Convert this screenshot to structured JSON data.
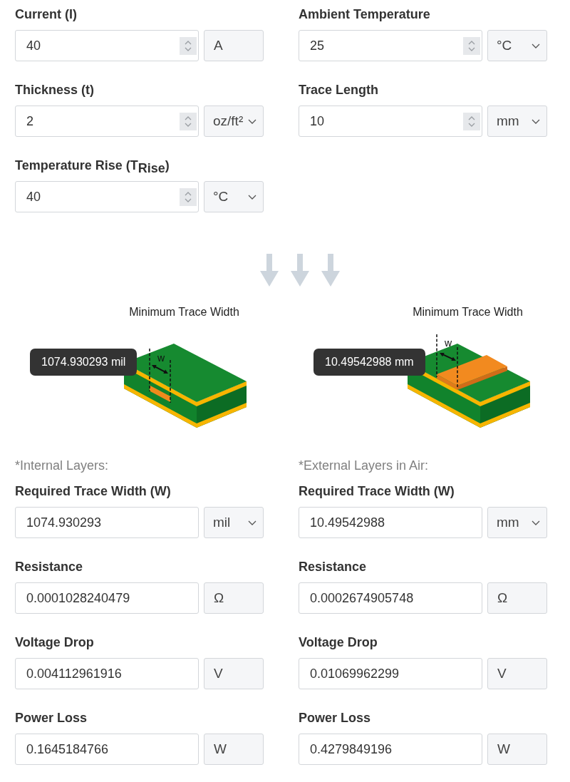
{
  "inputs": [
    {
      "label": "Current (I)",
      "value": "40",
      "unit": {
        "text": "A",
        "kind": "fixed"
      }
    },
    {
      "label": "Ambient Temperature",
      "value": "25",
      "unit": {
        "text": "°C",
        "kind": "dropdown"
      }
    },
    {
      "label": "Thickness (t)",
      "value": "2",
      "unit": {
        "text": "oz/ft²",
        "kind": "dropdown"
      }
    },
    {
      "label": "Trace Length",
      "value": "10",
      "unit": {
        "text": "mm",
        "kind": "dropdown"
      }
    },
    {
      "label": "Temperature Rise (T$_{Rise}$)",
      "value": "40",
      "unit": {
        "text": "°C",
        "kind": "dropdown"
      }
    }
  ],
  "results": [
    {
      "diagram": {
        "title": "Minimum Trace Width",
        "kind": "internal",
        "width_symbol": "w",
        "tooltip": "1074.930293 mil"
      },
      "note": "*Internal Layers:",
      "fields": [
        {
          "label": "Required Trace Width (W)",
          "value": "1074.930293",
          "unit": {
            "text": "mil",
            "kind": "dropdown"
          }
        },
        {
          "label": "Resistance",
          "value": "0.0001028240479",
          "unit": {
            "text": "Ω",
            "kind": "fixed"
          }
        },
        {
          "label": "Voltage Drop",
          "value": "0.004112961916",
          "unit": {
            "text": "V",
            "kind": "fixed"
          }
        },
        {
          "label": "Power Loss",
          "value": "0.1645184766",
          "unit": {
            "text": "W",
            "kind": "fixed"
          }
        }
      ]
    },
    {
      "diagram": {
        "title": "Minimum Trace Width",
        "kind": "external",
        "width_symbol": "w",
        "tooltip": "10.49542988 mm"
      },
      "note": "*External Layers in Air:",
      "fields": [
        {
          "label": "Required Trace Width (W)",
          "value": "10.49542988",
          "unit": {
            "text": "mm",
            "kind": "dropdown"
          }
        },
        {
          "label": "Resistance",
          "value": "0.0002674905748",
          "unit": {
            "text": "Ω",
            "kind": "fixed"
          }
        },
        {
          "label": "Voltage Drop",
          "value": "0.01069962299",
          "unit": {
            "text": "V",
            "kind": "fixed"
          }
        },
        {
          "label": "Power Loss",
          "value": "0.4279849196",
          "unit": {
            "text": "W",
            "kind": "fixed"
          }
        }
      ]
    }
  ]
}
